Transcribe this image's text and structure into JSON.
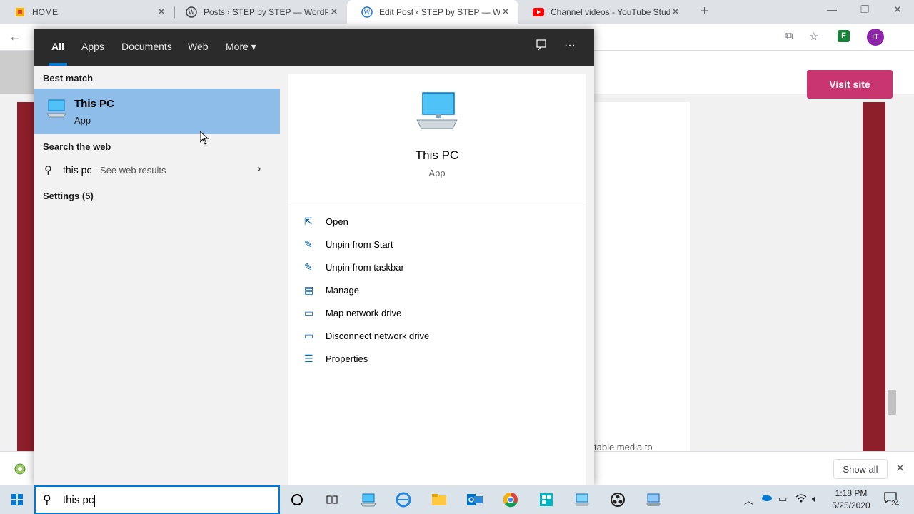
{
  "browser": {
    "tabs": [
      {
        "title": "HOME",
        "active": false
      },
      {
        "title": "Posts ‹ STEP by STEP — WordPre",
        "active": false
      },
      {
        "title": "Edit Post ‹ STEP by STEP — Word",
        "active": true
      },
      {
        "title": "Channel videos - YouTube Studio",
        "active": false
      }
    ],
    "profile_initials": "IT"
  },
  "page": {
    "visit_site": "Visit site",
    "fragment_text": "table media to",
    "show_all": "Show all"
  },
  "search": {
    "tabs": {
      "all": "All",
      "apps": "Apps",
      "documents": "Documents",
      "web": "Web",
      "more": "More"
    },
    "best_match_title": "Best match",
    "best_match": {
      "name": "This PC",
      "type": "App"
    },
    "search_web_title": "Search the web",
    "web_query": "this pc",
    "web_suffix": " - See web results",
    "settings_label": "Settings (5)",
    "detail": {
      "name": "This PC",
      "type": "App"
    },
    "actions": [
      {
        "label": "Open",
        "icon": "open-icon"
      },
      {
        "label": "Unpin from Start",
        "icon": "unpin-icon"
      },
      {
        "label": "Unpin from taskbar",
        "icon": "unpin-icon"
      },
      {
        "label": "Manage",
        "icon": "manage-icon"
      },
      {
        "label": "Map network drive",
        "icon": "network-drive-icon"
      },
      {
        "label": "Disconnect network drive",
        "icon": "network-drive-icon"
      },
      {
        "label": "Properties",
        "icon": "properties-icon"
      }
    ],
    "query": "this pc"
  },
  "taskbar": {
    "time": "1:18 PM",
    "date": "5/25/2020",
    "notifications": "24"
  },
  "colors": {
    "accent": "#0078d7",
    "selected": "#8fbde9",
    "visit_button": "#c9356e",
    "theme_red": "#8c1f2a"
  }
}
